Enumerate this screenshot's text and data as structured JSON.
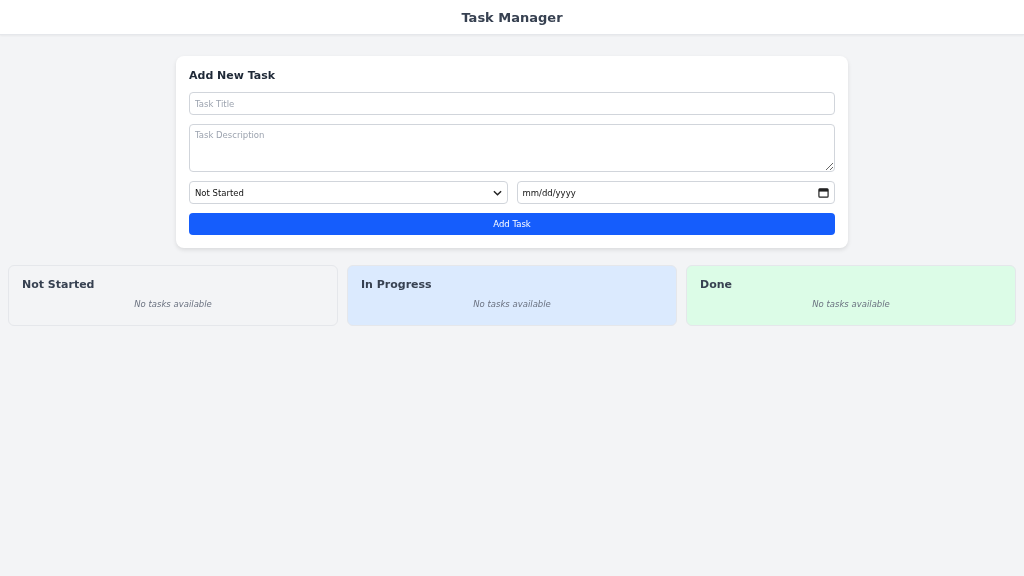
{
  "header": {
    "title": "Task Manager"
  },
  "form": {
    "heading": "Add New Task",
    "title_field": {
      "placeholder": "Task Title"
    },
    "description_field": {
      "placeholder": "Task Description"
    },
    "status_select": {
      "value": "Not Started"
    },
    "date_field": {
      "value": "mm/dd/yyyy"
    },
    "submit_button": "Add Task"
  },
  "columns": [
    {
      "title": "Not Started",
      "empty_text": "No tasks available",
      "color": "#f3f4f6"
    },
    {
      "title": "In Progress",
      "empty_text": "No tasks available",
      "color": "#dbeafe"
    },
    {
      "title": "Done",
      "empty_text": "No tasks available",
      "color": "#dcfce7"
    }
  ]
}
